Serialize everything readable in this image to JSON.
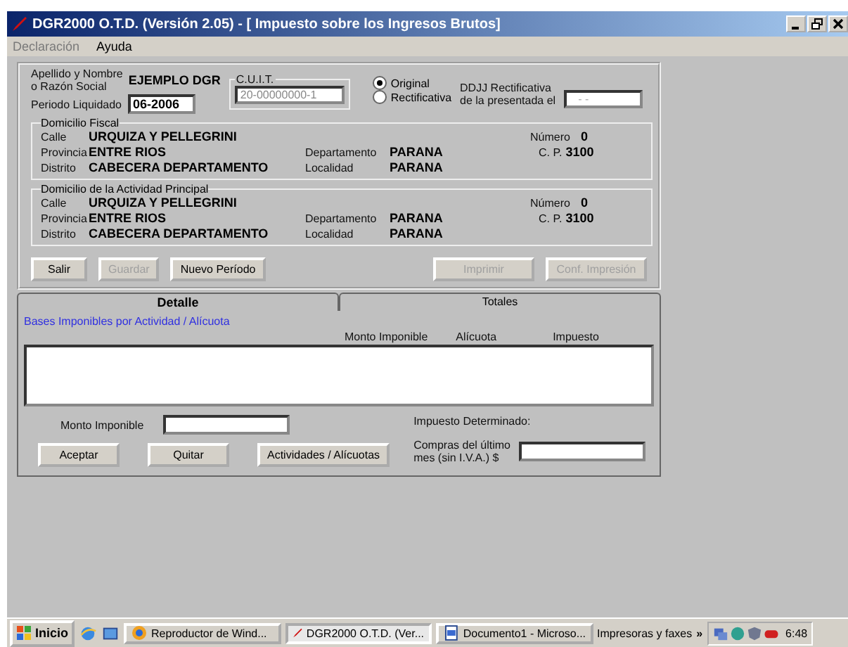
{
  "window": {
    "title": "DGR2000 O.T.D. (Versión 2.05) - [ Impuesto sobre los Ingresos Brutos]"
  },
  "menu": [
    {
      "label": "Declaración",
      "disabled": true
    },
    {
      "label": "Ayuda",
      "disabled": false
    }
  ],
  "header": {
    "name_label_1": "Apellido y Nombre",
    "name_label_2": "o Razón Social",
    "name_value": "EJEMPLO DGR",
    "period_label": "Periodo Liquidado",
    "period_value": "06-2006",
    "cuit_label": "C.U.I.T.",
    "cuit_value": "20-00000000-1",
    "radios": [
      {
        "label": "Original",
        "selected": true
      },
      {
        "label": "Rectificativa",
        "selected": false
      }
    ],
    "ddjj_label_1": "DDJJ Rectificativa",
    "ddjj_label_2": "de la presentada el",
    "ddjj_value": "- -"
  },
  "sections": [
    {
      "title": "Domicilio Fiscal",
      "calle": {
        "label": "Calle",
        "value": "URQUIZA Y PELLEGRINI"
      },
      "numero": {
        "label": "Número",
        "value": "0"
      },
      "provincia": {
        "label": "Provincia",
        "value": "ENTRE RIOS"
      },
      "departamento": {
        "label": "Departamento",
        "value": "PARANA"
      },
      "cp": {
        "label": "C. P.",
        "value": "3100"
      },
      "distrito": {
        "label": "Distrito",
        "value": "CABECERA DEPARTAMENTO"
      },
      "localidad": {
        "label": "Localidad",
        "value": "PARANA"
      }
    },
    {
      "title": "Domicilio de la Actividad Principal",
      "calle": {
        "label": "Calle",
        "value": "URQUIZA Y PELLEGRINI"
      },
      "numero": {
        "label": "Número",
        "value": "0"
      },
      "provincia": {
        "label": "Provincia",
        "value": "ENTRE RIOS"
      },
      "departamento": {
        "label": "Departamento",
        "value": "PARANA"
      },
      "cp": {
        "label": "C. P.",
        "value": "3100"
      },
      "distrito": {
        "label": "Distrito",
        "value": "CABECERA DEPARTAMENTO"
      },
      "localidad": {
        "label": "Localidad",
        "value": "PARANA"
      }
    }
  ],
  "buttons_left": [
    {
      "label": "Salir",
      "disabled": false
    },
    {
      "label": "Guardar",
      "disabled": true
    },
    {
      "label": "Nuevo Período",
      "disabled": false
    }
  ],
  "buttons_right": [
    {
      "label": "Imprimir",
      "disabled": true
    },
    {
      "label": "Conf. Impresión",
      "disabled": true
    }
  ],
  "tabs": [
    {
      "label": "Detalle",
      "selected": true
    },
    {
      "label": "Totales",
      "selected": false
    }
  ],
  "detail": {
    "caption": "Bases Imponibles por Actividad / Alícuota",
    "columns": [
      "Monto Imponible",
      "Alícuota",
      "Impuesto"
    ],
    "amount_label": "Monto Imponible",
    "determined_label": "Impuesto Determinado:",
    "compras_label_1": "Compras del último",
    "compras_label_2": "mes (sin I.V.A.) $",
    "buttons": [
      {
        "label": "Aceptar"
      },
      {
        "label": "Quitar"
      },
      {
        "label": "Actividades / Alícuotas"
      }
    ]
  },
  "taskbar": {
    "start": "Inicio",
    "tasks": [
      {
        "label": "Reproductor de Wind...",
        "kind": "media",
        "selected": false
      },
      {
        "label": "DGR2000 O.T.D. (Ver...",
        "kind": "pen",
        "selected": true
      },
      {
        "label": "Documento1 - Microso...",
        "kind": "doc",
        "selected": false
      }
    ],
    "toolbar": "Impresoras y faxes",
    "chevron": "»",
    "time": "6:48"
  }
}
